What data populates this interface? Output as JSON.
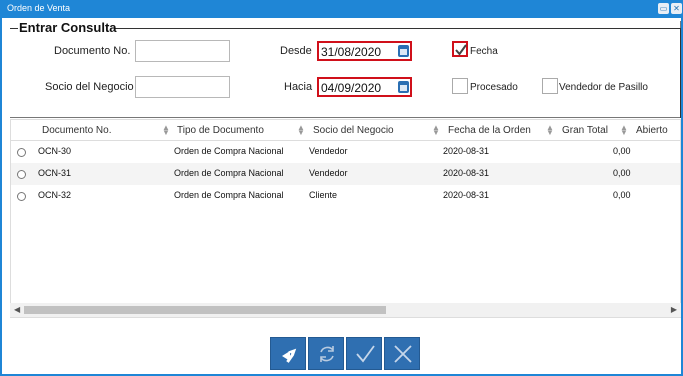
{
  "window": {
    "title": "Orden de Venta"
  },
  "query": {
    "title": "Entrar Consulta",
    "documento_label": "Documento No.",
    "documento_value": "",
    "socio_label": "Socio del Negocio",
    "socio_value": "",
    "desde_label": "Desde",
    "desde_value": "31/08/2020",
    "hacia_label": "Hacia",
    "hacia_value": "04/09/2020",
    "fecha_label": "Fecha",
    "fecha_checked": true,
    "procesado_label": "Procesado",
    "procesado_checked": false,
    "vendedor_label": "Vendedor de Pasillo",
    "vendedor_checked": false
  },
  "table": {
    "columns": [
      "Documento No.",
      "Tipo de Documento",
      "Socio del Negocio",
      "Fecha de la Orden",
      "Gran Total",
      "Abierto"
    ],
    "rows": [
      [
        "OCN-30",
        "Orden de Compra Nacional",
        "Vendedor",
        "2020-08-31",
        "0,00"
      ],
      [
        "OCN-31",
        "Orden de Compra Nacional",
        "Vendedor",
        "2020-08-31",
        "0,00"
      ],
      [
        "OCN-32",
        "Orden de Compra Nacional",
        "Cliente",
        "2020-08-31",
        "0,00"
      ]
    ]
  },
  "icons": {
    "minimize": "minimize-icon",
    "close": "close-icon",
    "calendar": "calendar-icon",
    "back": "back-arrow-icon",
    "refresh": "refresh-icon",
    "ok": "check-icon",
    "cancel": "x-icon"
  },
  "colors": {
    "accent": "#1f86d6",
    "highlight": "#d0101a",
    "button": "#2f6fb1"
  }
}
